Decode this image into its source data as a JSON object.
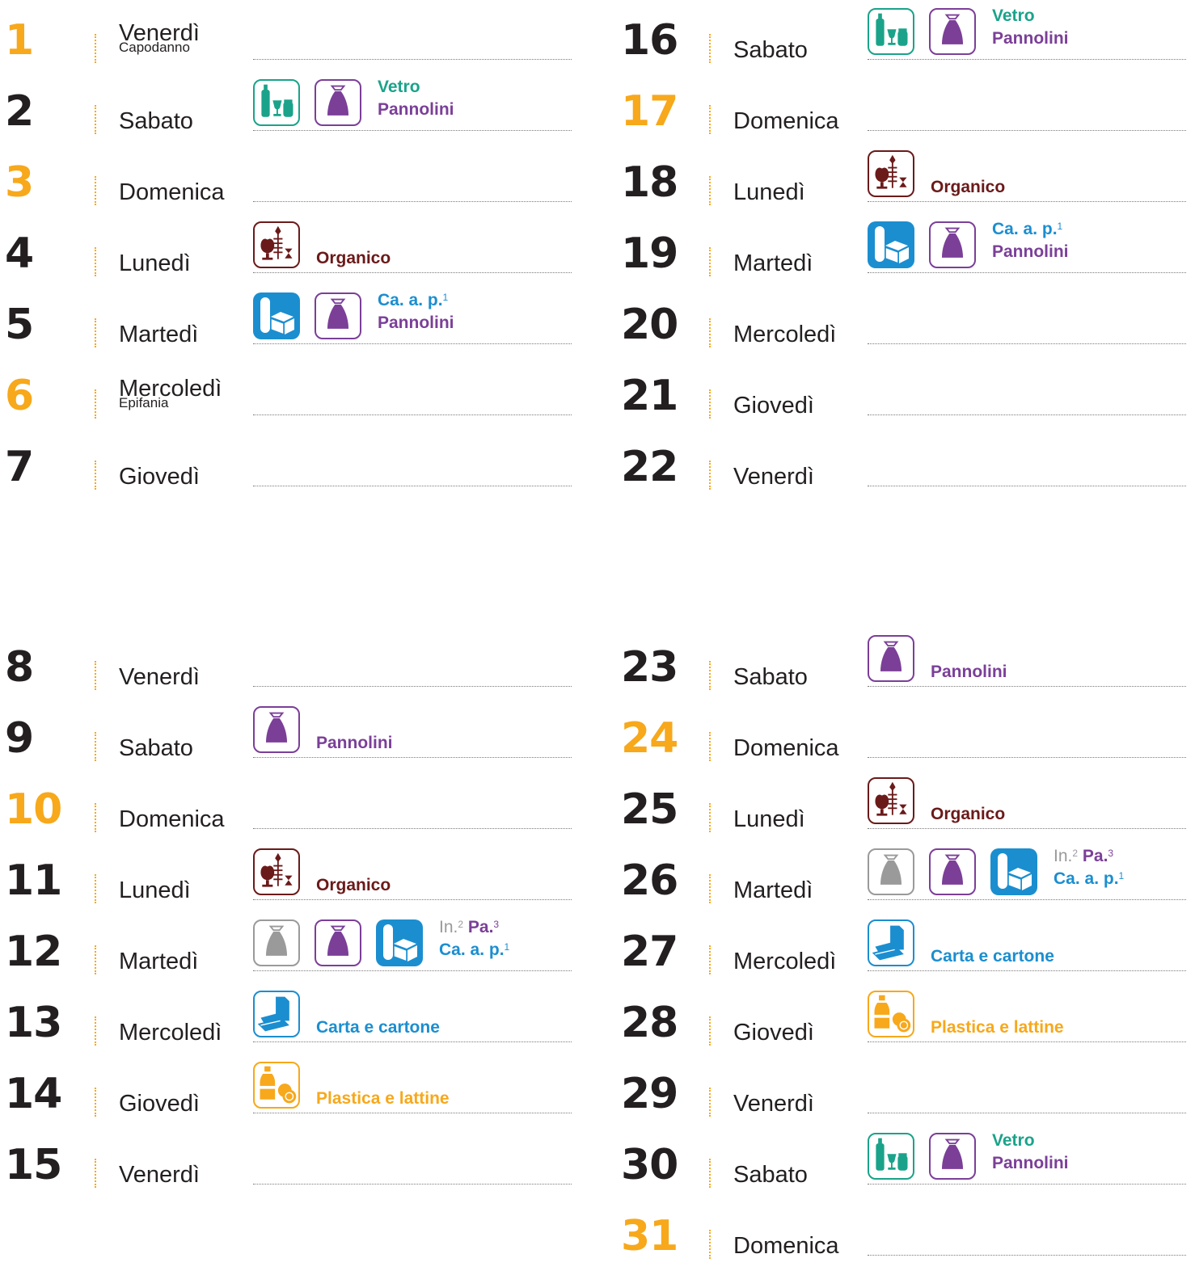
{
  "days": [
    {
      "num": "1",
      "name": "Venerdì",
      "note": "Capodanno",
      "holiday": true,
      "icons": [],
      "labels": []
    },
    {
      "num": "2",
      "name": "Sabato",
      "holiday": false,
      "icons": [
        "glass-icon",
        "bag-icon"
      ],
      "labels": [
        [
          {
            "t": "Vetro",
            "c": "glass"
          }
        ],
        [
          {
            "t": "Pannolini",
            "c": "bag"
          }
        ]
      ]
    },
    {
      "num": "3",
      "name": "Domenica",
      "holiday": true,
      "icons": [],
      "labels": []
    },
    {
      "num": "4",
      "name": "Lunedì",
      "holiday": false,
      "icons": [
        "organic-icon"
      ],
      "labels": [
        [
          {
            "t": "Organico",
            "c": "org"
          }
        ]
      ]
    },
    {
      "num": "5",
      "name": "Martedì",
      "holiday": false,
      "icons": [
        "box-icon",
        "bag-icon"
      ],
      "labels": [
        [
          {
            "t": "Ca. a. p.",
            "c": "box",
            "sup": "1"
          }
        ],
        [
          {
            "t": "Pannolini",
            "c": "bag"
          }
        ]
      ]
    },
    {
      "num": "6",
      "name": "Mercoledì",
      "note": "Epifania",
      "holiday": true,
      "icons": [],
      "labels": []
    },
    {
      "num": "7",
      "name": "Giovedì",
      "holiday": false,
      "icons": [],
      "labels": []
    },
    {
      "num": "8",
      "name": "Venerdì",
      "holiday": false,
      "icons": [],
      "labels": []
    },
    {
      "num": "9",
      "name": "Sabato",
      "holiday": false,
      "icons": [
        "bag-icon"
      ],
      "labels": [
        [
          {
            "t": "Pannolini",
            "c": "bag"
          }
        ]
      ]
    },
    {
      "num": "10",
      "name": "Domenica",
      "holiday": true,
      "icons": [],
      "labels": []
    },
    {
      "num": "11",
      "name": "Lunedì",
      "holiday": false,
      "icons": [
        "organic-icon"
      ],
      "labels": [
        [
          {
            "t": "Organico",
            "c": "org"
          }
        ]
      ]
    },
    {
      "num": "12",
      "name": "Martedì",
      "holiday": false,
      "icons": [
        "grey-bag-icon",
        "bag-icon",
        "box-icon"
      ],
      "labels": [
        [
          {
            "t": "In.",
            "c": "grey",
            "sup": "2",
            "light": true
          },
          {
            "t": " Pa.",
            "c": "bag",
            "sup": "3"
          }
        ],
        [
          {
            "t": "Ca. a. p.",
            "c": "box",
            "sup": "1"
          }
        ]
      ]
    },
    {
      "num": "13",
      "name": "Mercoledì",
      "holiday": false,
      "icons": [
        "paper-icon"
      ],
      "labels": [
        [
          {
            "t": "Carta e cartone",
            "c": "paper"
          }
        ]
      ]
    },
    {
      "num": "14",
      "name": "Giovedì",
      "holiday": false,
      "icons": [
        "plastic-icon"
      ],
      "labels": [
        [
          {
            "t": "Plastica e lattine",
            "c": "plastic"
          }
        ]
      ]
    },
    {
      "num": "15",
      "name": "Venerdì",
      "holiday": false,
      "icons": [],
      "labels": []
    },
    {
      "num": "16",
      "name": "Sabato",
      "holiday": false,
      "icons": [
        "glass-icon",
        "bag-icon"
      ],
      "labels": [
        [
          {
            "t": "Vetro",
            "c": "glass"
          }
        ],
        [
          {
            "t": "Pannolini",
            "c": "bag"
          }
        ]
      ]
    },
    {
      "num": "17",
      "name": "Domenica",
      "holiday": true,
      "icons": [],
      "labels": []
    },
    {
      "num": "18",
      "name": "Lunedì",
      "holiday": false,
      "icons": [
        "organic-icon"
      ],
      "labels": [
        [
          {
            "t": "Organico",
            "c": "org"
          }
        ]
      ]
    },
    {
      "num": "19",
      "name": "Martedì",
      "holiday": false,
      "icons": [
        "box-icon",
        "bag-icon"
      ],
      "labels": [
        [
          {
            "t": "Ca. a. p.",
            "c": "box",
            "sup": "1"
          }
        ],
        [
          {
            "t": "Pannolini",
            "c": "bag"
          }
        ]
      ]
    },
    {
      "num": "20",
      "name": "Mercoledì",
      "holiday": false,
      "icons": [],
      "labels": []
    },
    {
      "num": "21",
      "name": "Giovedì",
      "holiday": false,
      "icons": [],
      "labels": []
    },
    {
      "num": "22",
      "name": "Venerdì",
      "holiday": false,
      "icons": [],
      "labels": []
    },
    {
      "num": "23",
      "name": "Sabato",
      "holiday": false,
      "icons": [
        "bag-icon"
      ],
      "labels": [
        [
          {
            "t": "Pannolini",
            "c": "bag"
          }
        ]
      ]
    },
    {
      "num": "24",
      "name": "Domenica",
      "holiday": true,
      "icons": [],
      "labels": []
    },
    {
      "num": "25",
      "name": "Lunedì",
      "holiday": false,
      "icons": [
        "organic-icon"
      ],
      "labels": [
        [
          {
            "t": "Organico",
            "c": "org"
          }
        ]
      ]
    },
    {
      "num": "26",
      "name": "Martedì",
      "holiday": false,
      "icons": [
        "grey-bag-icon",
        "bag-icon",
        "box-icon"
      ],
      "labels": [
        [
          {
            "t": "In.",
            "c": "grey",
            "sup": "2",
            "light": true
          },
          {
            "t": " Pa.",
            "c": "bag",
            "sup": "3"
          }
        ],
        [
          {
            "t": "Ca. a. p.",
            "c": "box",
            "sup": "1"
          }
        ]
      ]
    },
    {
      "num": "27",
      "name": "Mercoledì",
      "holiday": false,
      "icons": [
        "paper-icon"
      ],
      "labels": [
        [
          {
            "t": "Carta e cartone",
            "c": "paper"
          }
        ]
      ]
    },
    {
      "num": "28",
      "name": "Giovedì",
      "holiday": false,
      "icons": [
        "plastic-icon"
      ],
      "labels": [
        [
          {
            "t": "Plastica e lattine",
            "c": "plastic"
          }
        ]
      ]
    },
    {
      "num": "29",
      "name": "Venerdì",
      "holiday": false,
      "icons": [],
      "labels": []
    },
    {
      "num": "30",
      "name": "Sabato",
      "holiday": false,
      "icons": [
        "glass-icon",
        "bag-icon"
      ],
      "labels": [
        [
          {
            "t": "Vetro",
            "c": "glass"
          }
        ],
        [
          {
            "t": "Pannolini",
            "c": "bag"
          }
        ]
      ]
    },
    {
      "num": "31",
      "name": "Domenica",
      "holiday": true,
      "icons": [],
      "labels": []
    }
  ],
  "colors": {
    "holiday": "#f7a81b",
    "text": "#231f20",
    "glass": "#1aa38a",
    "bag": "#7b3f98",
    "organic": "#6b1a1a",
    "box": "#1b8ed0",
    "grey": "#9a9a9a",
    "paper": "#1b8ed0",
    "plastic": "#f7a81b"
  }
}
